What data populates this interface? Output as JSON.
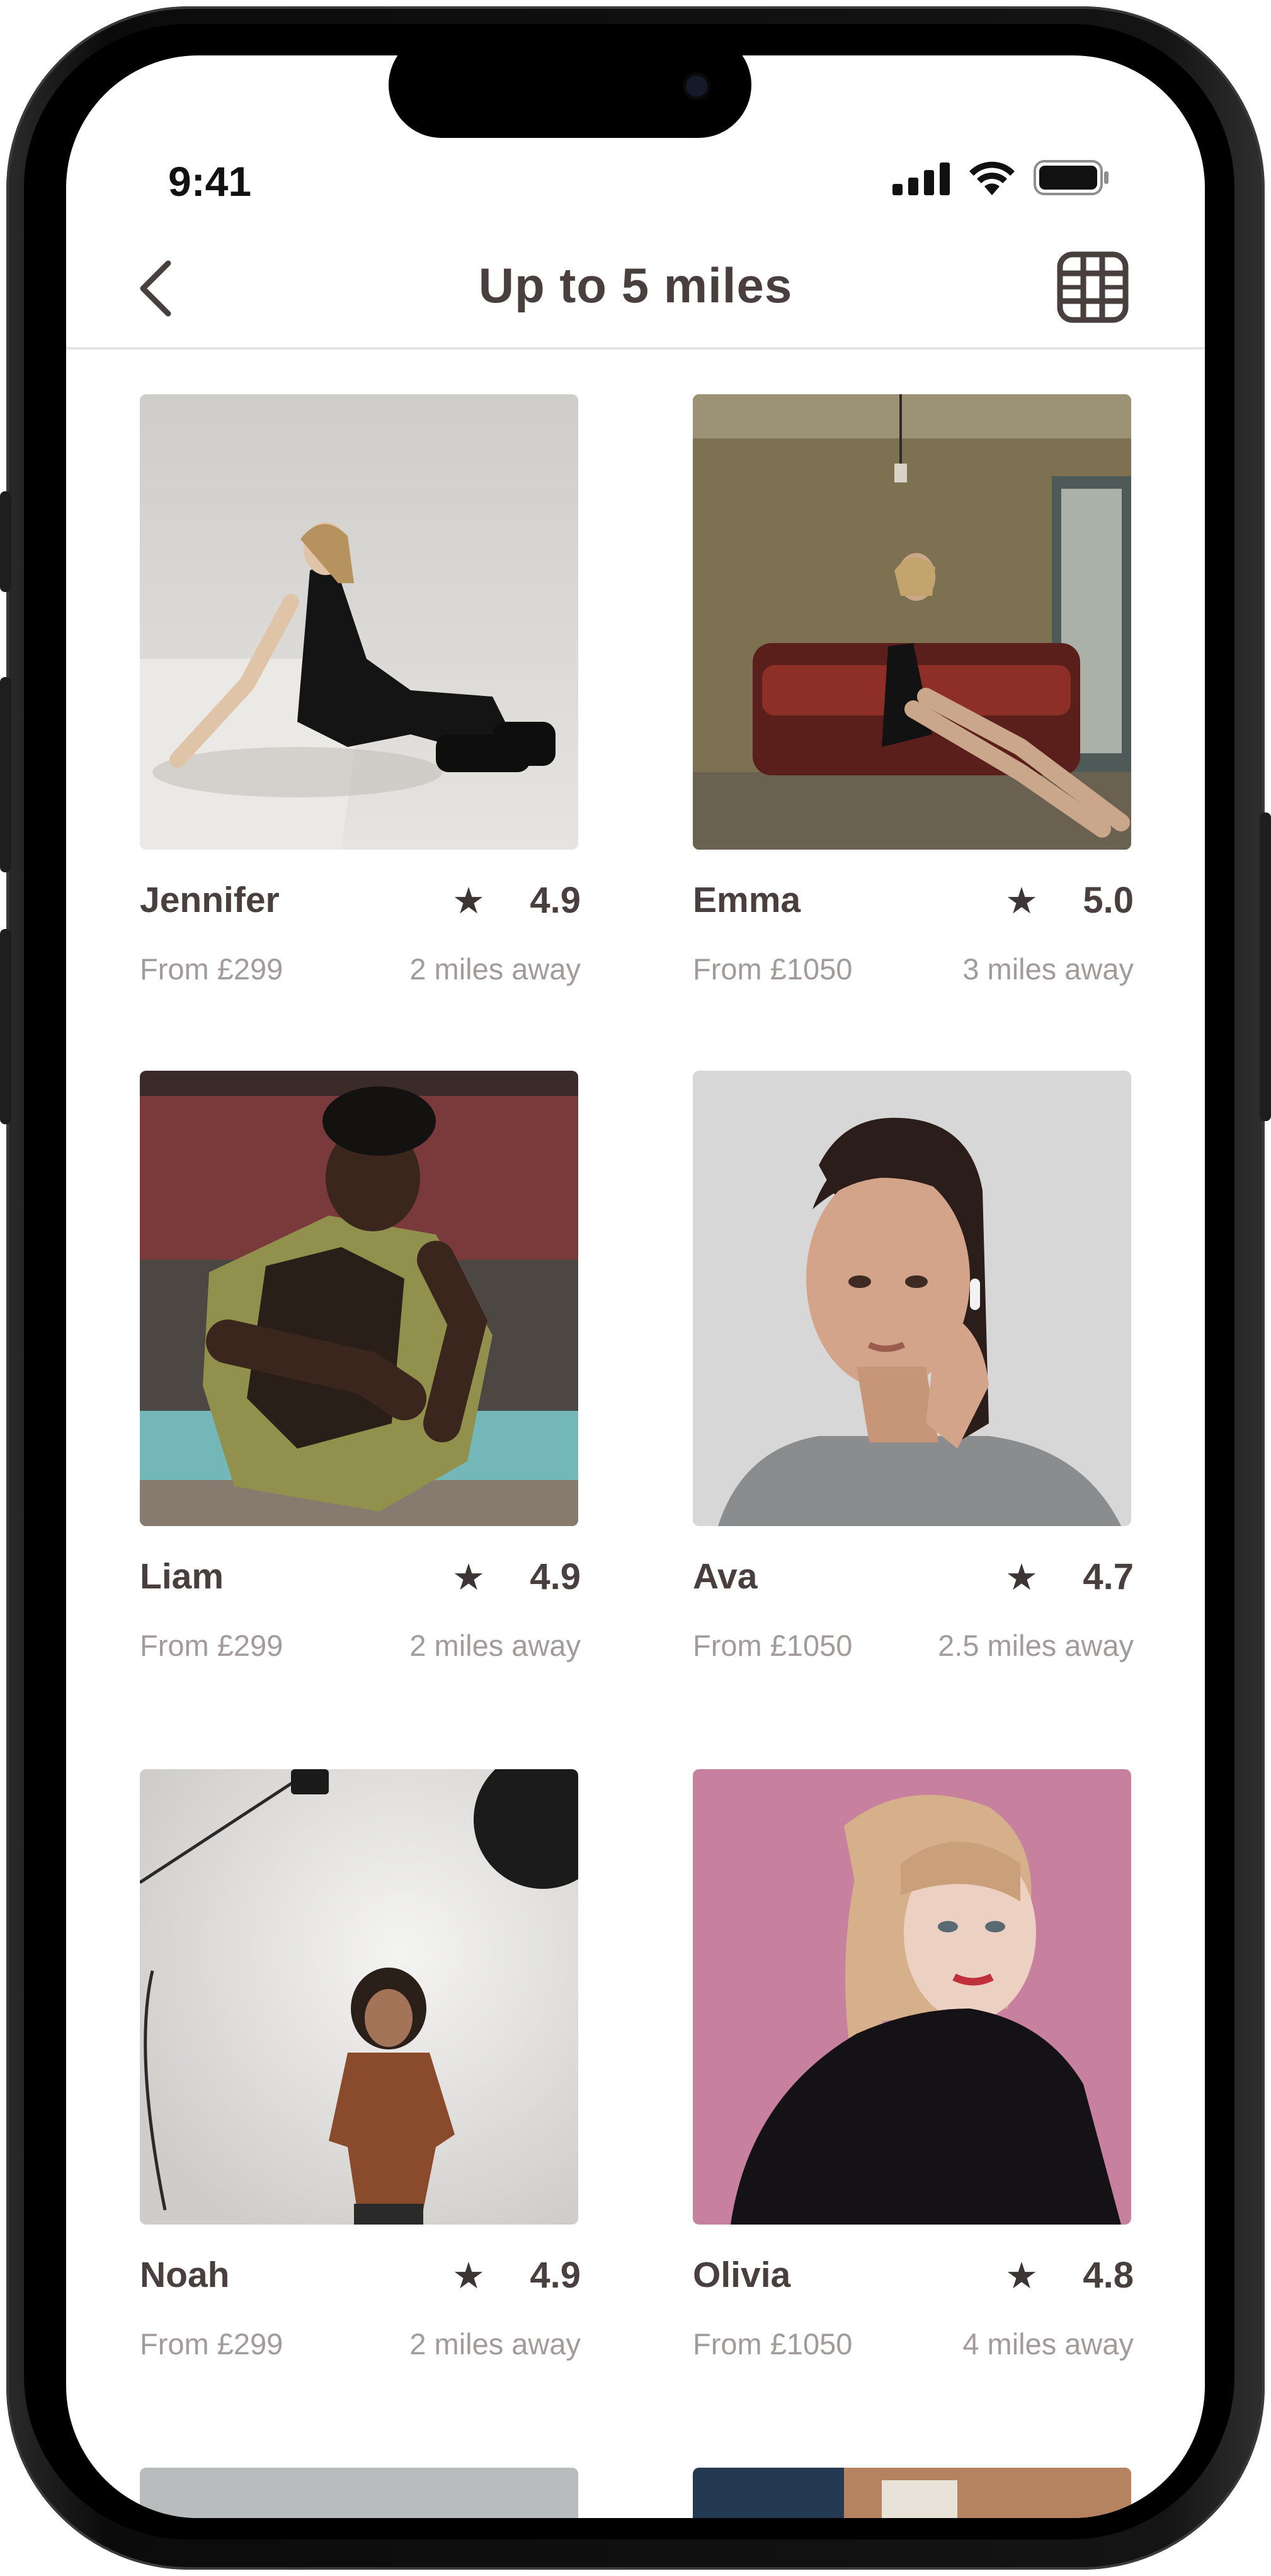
{
  "status_bar": {
    "time": "9:41"
  },
  "nav": {
    "title": "Up to 5 miles"
  },
  "colors": {
    "text": "#4a3f3f",
    "muted": "#a39b9b",
    "divider": "#e7e3e3"
  },
  "profiles": [
    {
      "name": "Jennifer",
      "rating": "4.9",
      "price": "From £299",
      "distance": "2 miles away"
    },
    {
      "name": "Emma",
      "rating": "5.0",
      "price": "From £1050",
      "distance": "3 miles away"
    },
    {
      "name": "Liam",
      "rating": "4.9",
      "price": "From £299",
      "distance": "2 miles away"
    },
    {
      "name": "Ava",
      "rating": "4.7",
      "price": "From £1050",
      "distance": "2.5 miles away"
    },
    {
      "name": "Noah",
      "rating": "4.9",
      "price": "From £299",
      "distance": "2 miles away"
    },
    {
      "name": "Olivia",
      "rating": "4.8",
      "price": "From £1050",
      "distance": "4 miles away"
    }
  ],
  "icons": {
    "back": "chevron-left-icon",
    "view": "grid-view-icon",
    "rating": "star-icon"
  }
}
